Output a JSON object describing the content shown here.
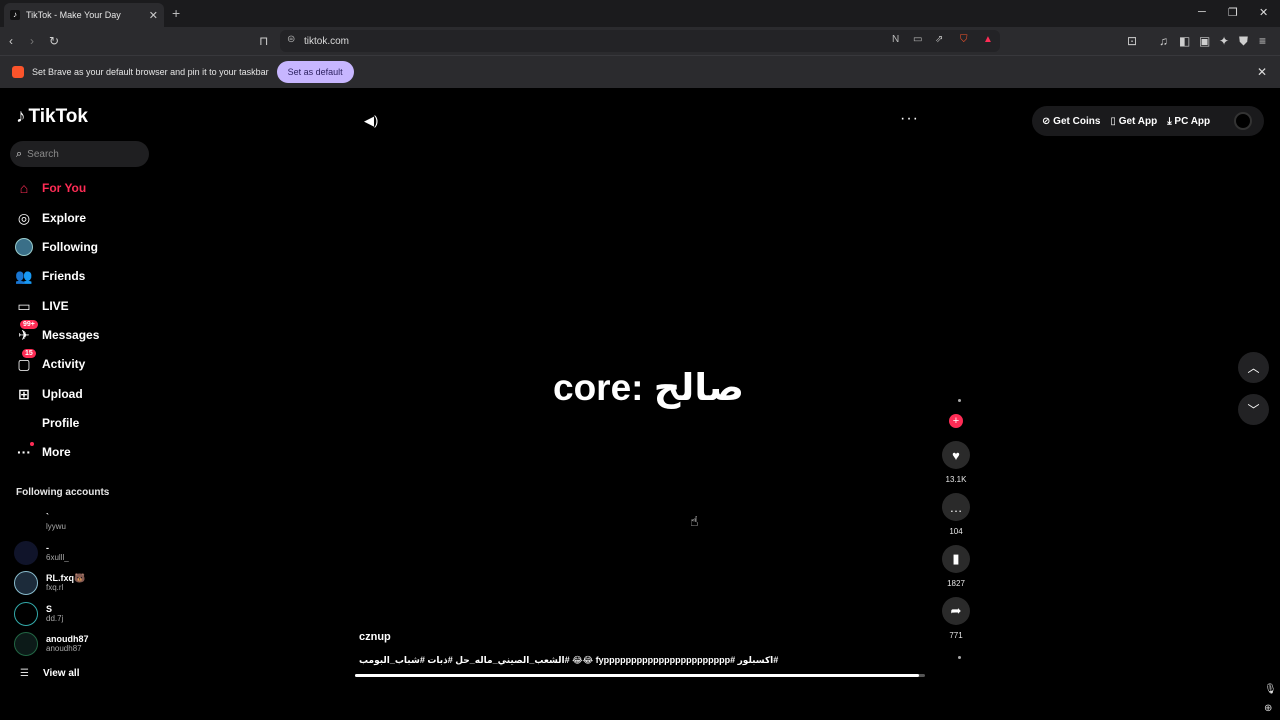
{
  "browser": {
    "tab_title": "TikTok - Make Your Day",
    "tab_close": "✕",
    "new_tab": "+",
    "url": "tiktok.com",
    "window_controls": [
      "─",
      "❐",
      "✕"
    ],
    "infobar_text": "Set Brave as your default browser and pin it to your taskbar",
    "infobar_button": "Set as default",
    "infobar_close": "✕",
    "shield_badge": "6",
    "rewards_badge": "1"
  },
  "tiktok": {
    "logo_text": "TikTok",
    "search_placeholder": "Search",
    "nav": [
      {
        "label": "For You",
        "icon": "home-icon",
        "active": true
      },
      {
        "label": "Explore",
        "icon": "compass-icon"
      },
      {
        "label": "Following",
        "icon": "following-avatar-icon"
      },
      {
        "label": "Friends",
        "icon": "friends-icon"
      },
      {
        "label": "LIVE",
        "icon": "live-tv-icon"
      },
      {
        "label": "Messages",
        "icon": "messages-icon",
        "badge": "99+"
      },
      {
        "label": "Activity",
        "icon": "activity-icon",
        "badge": "15"
      },
      {
        "label": "Upload",
        "icon": "upload-plus-icon"
      },
      {
        "label": "Profile",
        "icon": "profile-avatar-icon"
      },
      {
        "label": "More",
        "icon": "more-dots-icon"
      }
    ],
    "following_title": "Following accounts",
    "following": [
      {
        "name": "`",
        "handle": "lyywu"
      },
      {
        "name": "-",
        "handle": "6xulll_"
      },
      {
        "name": "RL.fxq🐻",
        "handle": "fxq.rl"
      },
      {
        "name": "S",
        "handle": "dd.7j"
      },
      {
        "name": "anoudh87",
        "handle": "anoudh87"
      }
    ],
    "view_all": "View all",
    "top_right": {
      "get_coins": "Get Coins",
      "get_app": "Get App",
      "pc_app": "PC App"
    },
    "video": {
      "overlay_text": "core: صالح",
      "author": "cznup",
      "caption": "#اكسبلور #fyppppppppppppppppppppppp 😂😂 #الشعب_الصيني_ماله_حل #ذبات #شباب_البومب",
      "likes": "13.1K",
      "comments": "104",
      "saves": "1827",
      "shares": "771",
      "progress": 0.99
    }
  },
  "colors": {
    "accent": "#fe2c55",
    "background": "#000000"
  }
}
